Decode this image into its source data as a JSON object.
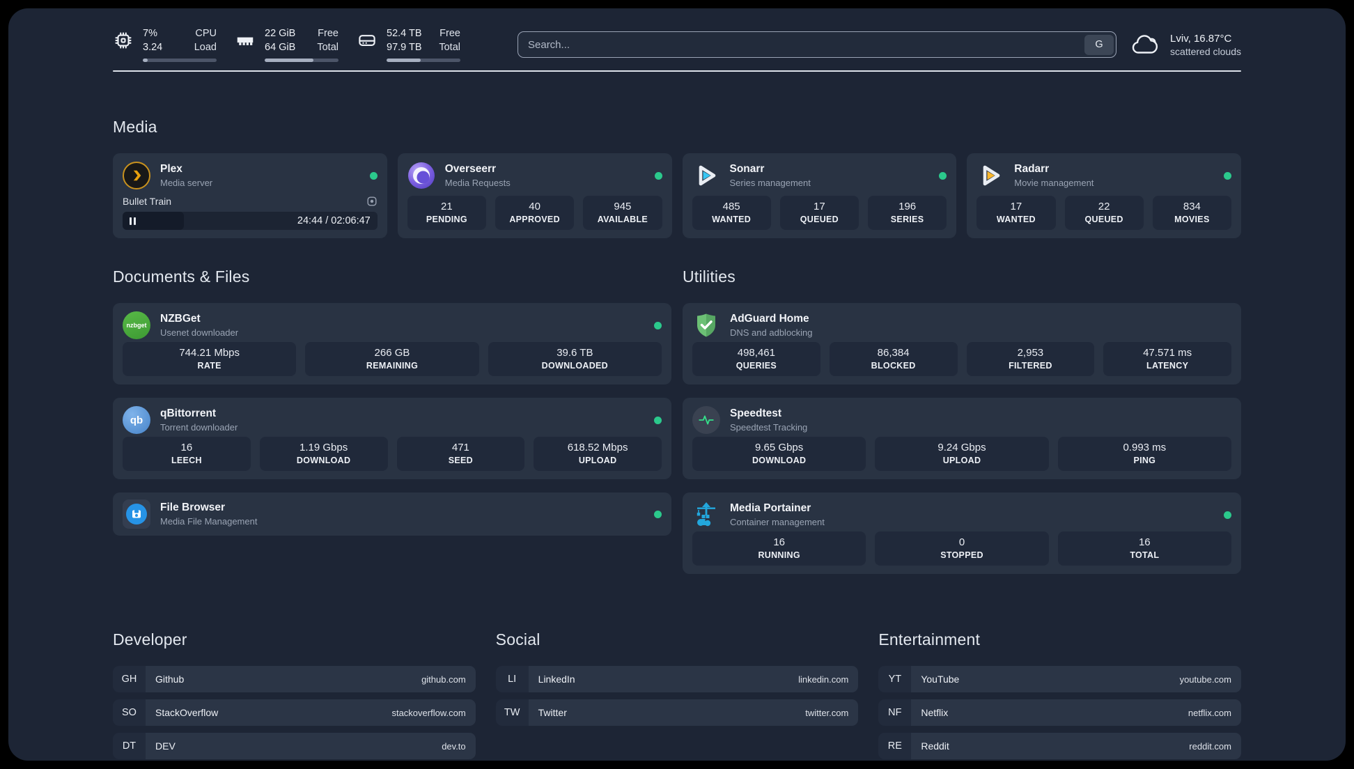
{
  "theme": {
    "background": "#1d2535",
    "card": "#293343",
    "stat_box": "#20293a",
    "status_green": "#2bc98c",
    "divider": "#dde2ea"
  },
  "header": {
    "cpu": {
      "value": "7%",
      "value2": "3.24",
      "label": "CPU",
      "label2": "Load",
      "progress_pct": 7,
      "icon": "cpu-icon"
    },
    "memory": {
      "value": "22 GiB",
      "value2": "64 GiB",
      "label": "Free",
      "label2": "Total",
      "progress_pct": 66,
      "icon": "memory-icon"
    },
    "disk": {
      "value": "52.4 TB",
      "value2": "97.9 TB",
      "label": "Free",
      "label2": "Total",
      "progress_pct": 46,
      "icon": "disk-icon"
    },
    "search": {
      "placeholder": "Search...",
      "button_label": "G"
    },
    "weather": {
      "location": "Lviv, 16.87°C",
      "condition": "scattered clouds",
      "icon": "cloud-icon"
    }
  },
  "media": {
    "title": "Media",
    "cards": [
      {
        "name": "Plex",
        "description": "Media server",
        "status": "online",
        "icon": "plex-icon",
        "now_playing": {
          "title": "Bullet Train",
          "time": "24:44 / 02:06:47",
          "state": "paused"
        }
      },
      {
        "name": "Overseerr",
        "description": "Media Requests",
        "status": "online",
        "icon": "overseerr-icon",
        "stats": [
          {
            "value": "21",
            "label": "PENDING"
          },
          {
            "value": "40",
            "label": "APPROVED"
          },
          {
            "value": "945",
            "label": "AVAILABLE"
          }
        ]
      },
      {
        "name": "Sonarr",
        "description": "Series management",
        "status": "online",
        "icon": "sonarr-icon",
        "stats": [
          {
            "value": "485",
            "label": "WANTED"
          },
          {
            "value": "17",
            "label": "QUEUED"
          },
          {
            "value": "196",
            "label": "SERIES"
          }
        ]
      },
      {
        "name": "Radarr",
        "description": "Movie management",
        "status": "online",
        "icon": "radarr-icon",
        "stats": [
          {
            "value": "17",
            "label": "WANTED"
          },
          {
            "value": "22",
            "label": "QUEUED"
          },
          {
            "value": "834",
            "label": "MOVIES"
          }
        ]
      }
    ]
  },
  "documents": {
    "title": "Documents & Files",
    "cards": [
      {
        "name": "NZBGet",
        "description": "Usenet downloader",
        "status": "online",
        "icon": "nzbget-icon",
        "icon_text": "nzbget",
        "stats": [
          {
            "value": "744.21 Mbps",
            "label": "RATE"
          },
          {
            "value": "266 GB",
            "label": "REMAINING"
          },
          {
            "value": "39.6 TB",
            "label": "DOWNLOADED"
          }
        ]
      },
      {
        "name": "qBittorrent",
        "description": "Torrent downloader",
        "status": "online",
        "icon": "qbittorrent-icon",
        "icon_text": "qb",
        "stats": [
          {
            "value": "16",
            "label": "LEECH"
          },
          {
            "value": "1.19 Gbps",
            "label": "DOWNLOAD"
          },
          {
            "value": "471",
            "label": "SEED"
          },
          {
            "value": "618.52 Mbps",
            "label": "UPLOAD"
          }
        ]
      },
      {
        "name": "File Browser",
        "description": "Media File Management",
        "status": "online",
        "icon": "filebrowser-icon"
      }
    ]
  },
  "utilities": {
    "title": "Utilities",
    "cards": [
      {
        "name": "AdGuard Home",
        "description": "DNS and adblocking",
        "icon": "adguard-icon",
        "stats": [
          {
            "value": "498,461",
            "label": "QUERIES"
          },
          {
            "value": "86,384",
            "label": "BLOCKED"
          },
          {
            "value": "2,953",
            "label": "FILTERED"
          },
          {
            "value": "47.571 ms",
            "label": "LATENCY"
          }
        ]
      },
      {
        "name": "Speedtest",
        "description": "Speedtest Tracking",
        "icon": "speedtest-icon",
        "stats": [
          {
            "value": "9.65 Gbps",
            "label": "DOWNLOAD"
          },
          {
            "value": "9.24 Gbps",
            "label": "UPLOAD"
          },
          {
            "value": "0.993 ms",
            "label": "PING"
          }
        ]
      },
      {
        "name": "Media Portainer",
        "description": "Container management",
        "status": "online",
        "icon": "portainer-icon",
        "stats": [
          {
            "value": "16",
            "label": "RUNNING"
          },
          {
            "value": "0",
            "label": "STOPPED"
          },
          {
            "value": "16",
            "label": "TOTAL"
          }
        ]
      }
    ]
  },
  "bookmarks": {
    "developer": {
      "title": "Developer",
      "items": [
        {
          "abbr": "GH",
          "name": "Github",
          "url": "github.com"
        },
        {
          "abbr": "SO",
          "name": "StackOverflow",
          "url": "stackoverflow.com"
        },
        {
          "abbr": "DT",
          "name": "DEV",
          "url": "dev.to"
        }
      ]
    },
    "social": {
      "title": "Social",
      "items": [
        {
          "abbr": "LI",
          "name": "LinkedIn",
          "url": "linkedin.com"
        },
        {
          "abbr": "TW",
          "name": "Twitter",
          "url": "twitter.com"
        }
      ]
    },
    "entertainment": {
      "title": "Entertainment",
      "items": [
        {
          "abbr": "YT",
          "name": "YouTube",
          "url": "youtube.com"
        },
        {
          "abbr": "NF",
          "name": "Netflix",
          "url": "netflix.com"
        },
        {
          "abbr": "RE",
          "name": "Reddit",
          "url": "reddit.com"
        }
      ]
    }
  }
}
